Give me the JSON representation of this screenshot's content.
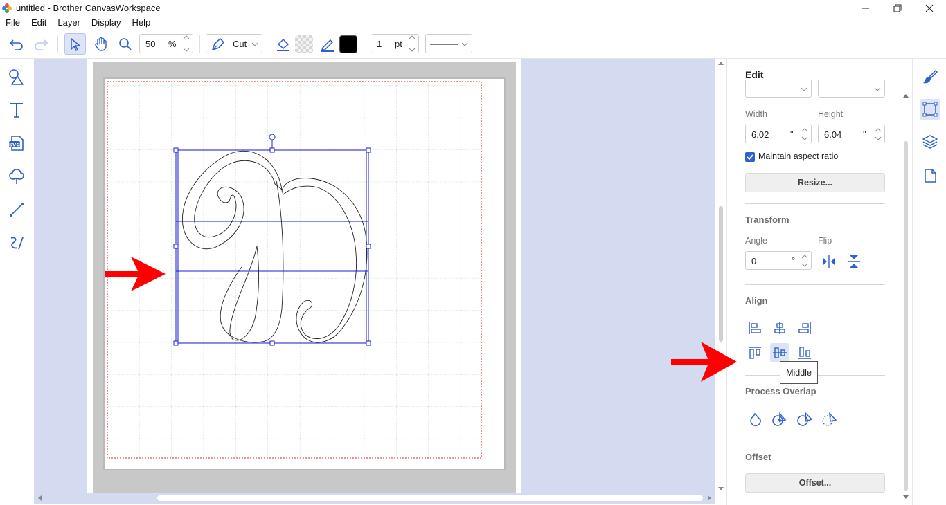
{
  "window": {
    "title": "untitled - Brother CanvasWorkspace"
  },
  "menu": [
    "File",
    "Edit",
    "Layer",
    "Display",
    "Help"
  ],
  "toolbar": {
    "zoom_value": "50",
    "zoom_unit": "%",
    "mode_label": "Cut",
    "line_width_value": "1",
    "line_width_unit": "pt",
    "stroke_color": "#000000"
  },
  "left_tools": [
    "shapes-icon",
    "text-icon",
    "svg-import-icon",
    "pattern-icon",
    "line-icon",
    "freehand-icon"
  ],
  "panel": {
    "title": "Edit",
    "width_label": "Width",
    "height_label": "Height",
    "width_value": "6.02",
    "height_value": "6.04",
    "unit": "\"",
    "aspect_label": "Maintain aspect ratio",
    "aspect_checked": true,
    "resize_button": "Resize...",
    "transform_heading": "Transform",
    "angle_label": "Angle",
    "flip_label": "Flip",
    "angle_value": "0",
    "angle_unit": "°",
    "align_heading": "Align",
    "tooltip": "Middle",
    "process_heading": "Process Overlap",
    "offset_heading": "Offset",
    "offset_button": "Offset..."
  },
  "colors": {
    "accent": "#2f5fd0",
    "canvas_bg": "#d4daf0",
    "selection": "#1a1ad8",
    "cut_border": "#e02020",
    "arrow": "#ff0000"
  }
}
